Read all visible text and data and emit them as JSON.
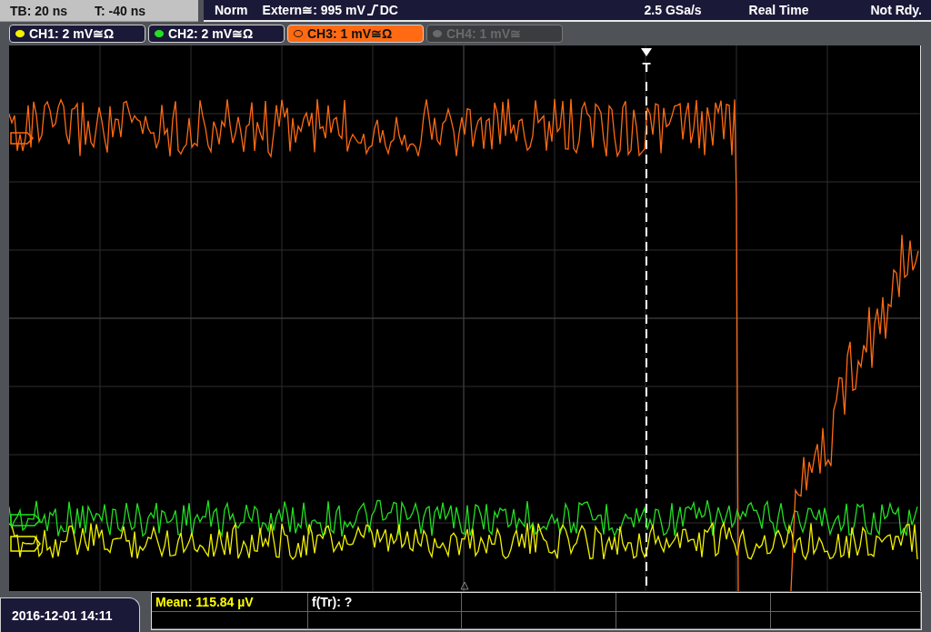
{
  "status_bar": {
    "timebase": "TB: 20 ns",
    "trigger_offset": "T: -40 ns",
    "acquisition_mode": "Norm",
    "trigger_source": "Extern≅: 995 mV",
    "trigger_coupling": "DC",
    "sample_rate": "2.5 GSa/s",
    "timing_mode": "Real Time",
    "state": "Not Rdy."
  },
  "channels": [
    {
      "label": "CH1: 2 mV≅Ω",
      "color": "#f2f200",
      "selected": false,
      "on": true
    },
    {
      "label": "CH2: 2 mV≅Ω",
      "color": "#22e022",
      "selected": false,
      "on": true
    },
    {
      "label": "CH3: 1 mV≅Ω",
      "color": "#ff6a13",
      "selected": true,
      "on": true
    },
    {
      "label": "CH4: 1 mV≅",
      "color": "#6a6a6a",
      "selected": false,
      "on": false
    }
  ],
  "trigger_marker": "T",
  "measurements": [
    {
      "text": "Mean: 115.84 µV",
      "color": "#ffff00"
    },
    {
      "text": "f(Tr): ?",
      "color": "#ffffff"
    }
  ],
  "timestamp": "2016-12-01 14:11"
}
